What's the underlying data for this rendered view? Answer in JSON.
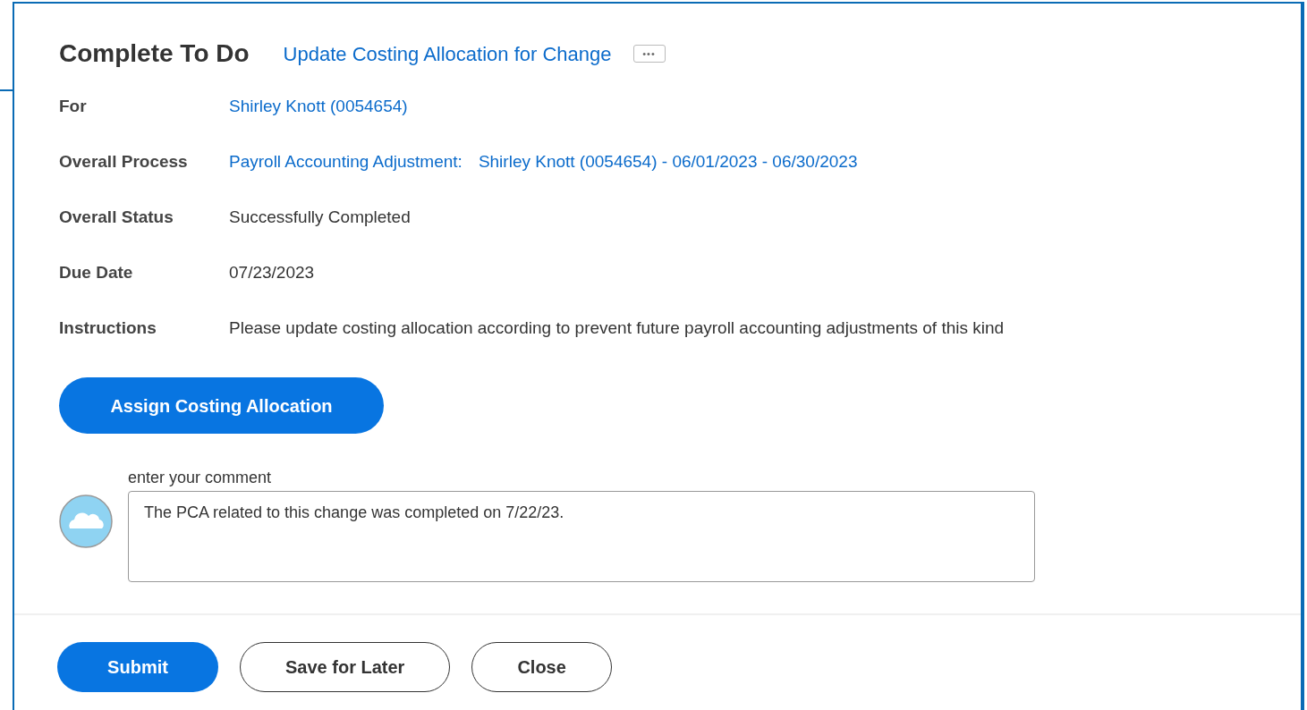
{
  "header": {
    "title": "Complete To Do",
    "task_link": "Update Costing Allocation for Change",
    "more_button": "•••"
  },
  "fields": [
    {
      "label": "For",
      "kind": "link",
      "parts": [
        "Shirley Knott (0054654)"
      ]
    },
    {
      "label": "Overall Process",
      "kind": "link",
      "parts": [
        "Payroll Accounting Adjustment:",
        "Shirley Knott (0054654) - 06/01/2023 - 06/30/2023"
      ]
    },
    {
      "label": "Overall Status",
      "kind": "text",
      "parts": [
        "Successfully Completed"
      ]
    },
    {
      "label": "Due Date",
      "kind": "text",
      "parts": [
        "07/23/2023"
      ]
    },
    {
      "label": "Instructions",
      "kind": "text",
      "parts": [
        "Please update costing allocation according to prevent future payroll accounting adjustments of this kind"
      ]
    }
  ],
  "action_button": "Assign Costing Allocation",
  "comment": {
    "label": "enter your comment",
    "value": "The PCA related to this change was completed on 7/22/23."
  },
  "footer_buttons": [
    {
      "label": "Submit",
      "kind": "primary"
    },
    {
      "label": "Save for Later",
      "kind": "secondary"
    },
    {
      "label": "Close",
      "kind": "secondary"
    }
  ]
}
